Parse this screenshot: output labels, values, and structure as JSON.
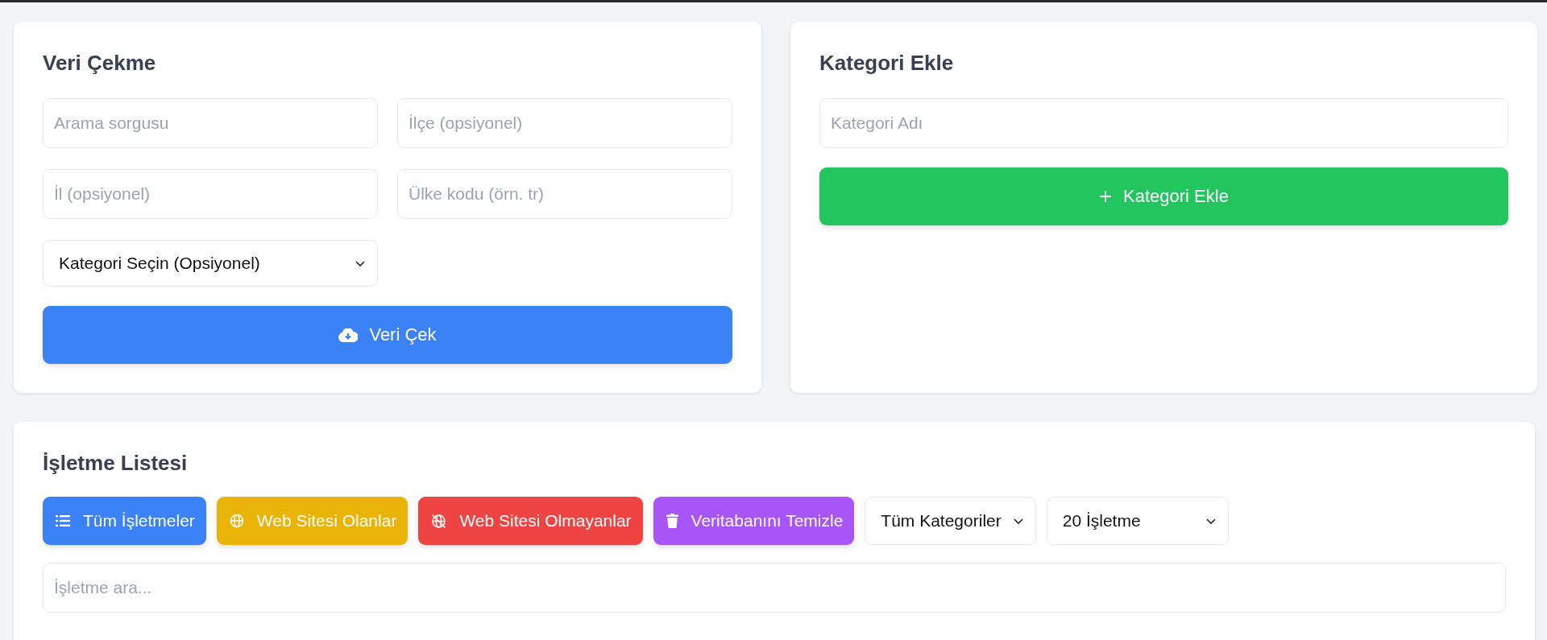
{
  "fetch_panel": {
    "title": "Veri Çekme",
    "fields": [
      {
        "placeholder": "Arama sorgusu"
      },
      {
        "placeholder": "İlçe (opsiyonel)"
      },
      {
        "placeholder": "İl (opsiyonel)"
      },
      {
        "placeholder": "Ülke kodu (örn. tr)"
      }
    ],
    "category_select": {
      "value": "Kategori Seçin (Opsiyonel)"
    },
    "button": "Veri Çek"
  },
  "category_panel": {
    "title": "Kategori Ekle",
    "field": {
      "placeholder": "Kategori Adı"
    },
    "button": "Kategori Ekle"
  },
  "business_panel": {
    "title": "İşletme Listesi",
    "filters": [
      {
        "kind": "all",
        "label": "Tüm İşletmeler",
        "color": "#3b82f6"
      },
      {
        "kind": "with_website",
        "label": "Web Sitesi Olanlar",
        "color": "#eab308"
      },
      {
        "kind": "without_website",
        "label": "Web Sitesi Olmayanlar",
        "color": "#ef4444"
      },
      {
        "kind": "clear",
        "label": "Veritabanını Temizle",
        "color": "#a855f7"
      }
    ],
    "selects": [
      {
        "value": "Tüm Kategoriler"
      },
      {
        "value": "20 İşletme"
      }
    ],
    "search": {
      "placeholder": "İşletme ara..."
    }
  }
}
